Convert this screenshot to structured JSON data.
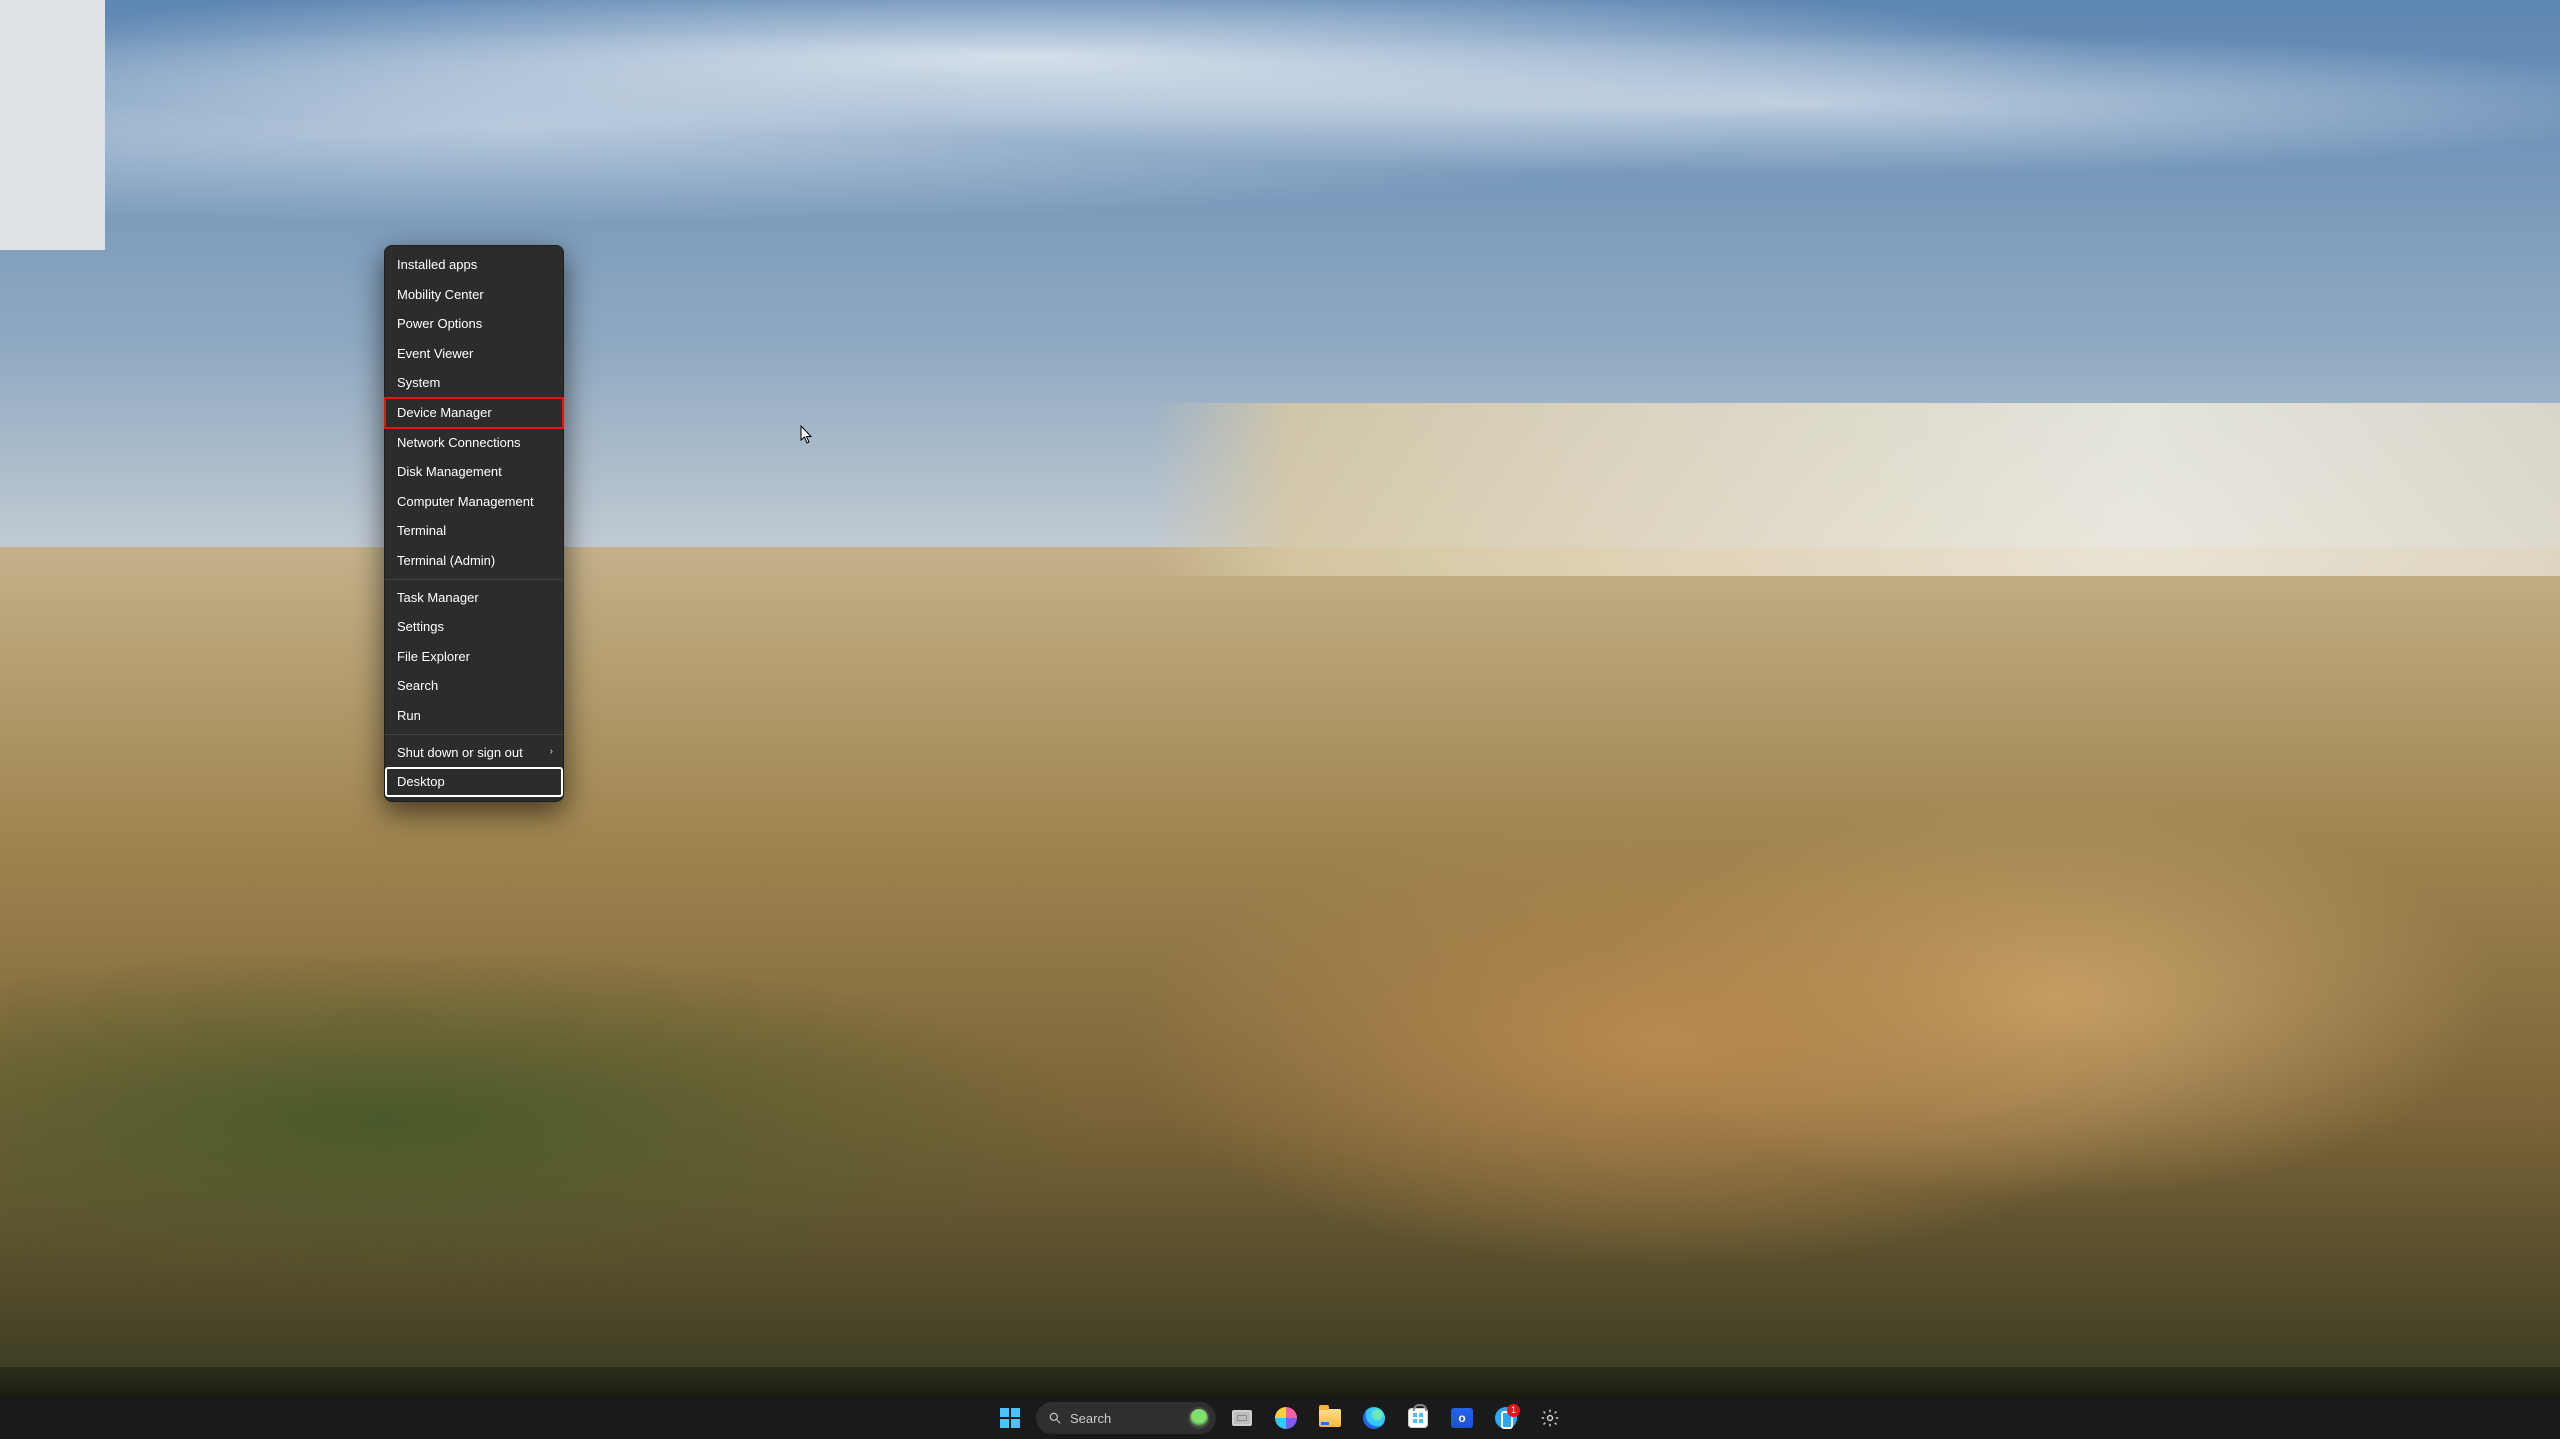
{
  "winx_menu": {
    "groups": [
      [
        {
          "label": "Installed apps"
        },
        {
          "label": "Mobility Center"
        },
        {
          "label": "Power Options"
        },
        {
          "label": "Event Viewer"
        },
        {
          "label": "System"
        },
        {
          "label": "Device Manager",
          "red_highlight": true
        },
        {
          "label": "Network Connections"
        },
        {
          "label": "Disk Management"
        },
        {
          "label": "Computer Management"
        },
        {
          "label": "Terminal"
        },
        {
          "label": "Terminal (Admin)"
        }
      ],
      [
        {
          "label": "Task Manager"
        },
        {
          "label": "Settings"
        },
        {
          "label": "File Explorer"
        },
        {
          "label": "Search"
        },
        {
          "label": "Run"
        }
      ],
      [
        {
          "label": "Shut down or sign out",
          "submenu": true
        },
        {
          "label": "Desktop",
          "white_highlight": true
        }
      ]
    ]
  },
  "taskbar": {
    "search_placeholder": "Search",
    "outlook_letter": "o",
    "phone_badge": "1"
  }
}
